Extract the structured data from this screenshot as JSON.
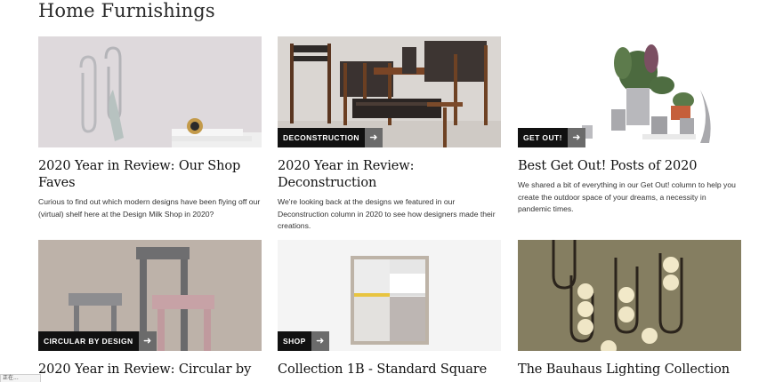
{
  "section": {
    "title": "Home Furnishings"
  },
  "cards": [
    {
      "title": "2020 Year in Review: Our Shop Faves",
      "excerpt": "Curious to find out which modern designs have been flying off our (virtual) shelf here at the Design Milk Shop in 2020?",
      "tag": "",
      "image": "wall-hooks-photo"
    },
    {
      "title": "2020 Year in Review: Deconstruction",
      "excerpt": "We're looking back at the designs we featured in our Deconstruction column in 2020 to see how designers made their creations.",
      "tag": "DECONSTRUCTION",
      "image": "woven-chairs-photo"
    },
    {
      "title": "Best Get Out! Posts of 2020",
      "excerpt": "We shared a bit of everything in our Get Out! column to help you create the outdoor space of your dreams, a necessity in pandemic times.",
      "tag": "GET OUT!",
      "image": "planters-photo"
    },
    {
      "title": "2020 Year in Review: Circular by",
      "excerpt": "",
      "tag": "CIRCULAR BY DESIGN",
      "image": "concrete-furniture-photo"
    },
    {
      "title": "Collection 1B - Standard Square",
      "excerpt": "",
      "tag": "SHOP",
      "image": "art-print-photo"
    },
    {
      "title": "The Bauhaus Lighting Collection",
      "excerpt": "",
      "tag": "",
      "image": "bauhaus-lights-photo"
    }
  ],
  "status": {
    "text": "正在..."
  },
  "colors": {
    "tag_bg": "#111111",
    "tag_arrow_bg": "#6b6b6b",
    "accent_yellow": "#e8c440"
  }
}
